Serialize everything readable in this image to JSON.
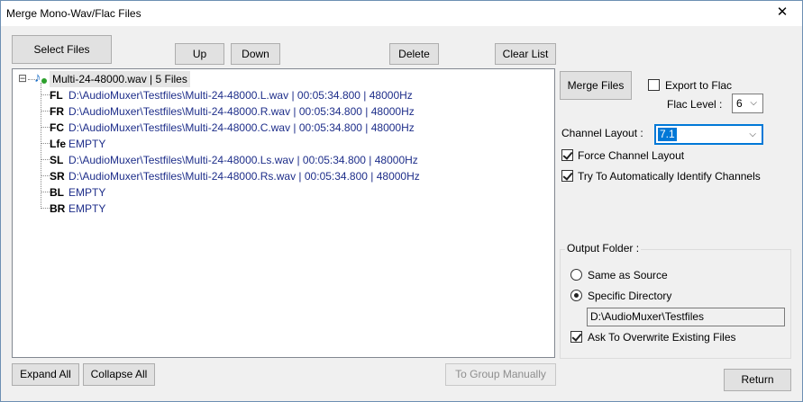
{
  "window": {
    "title": "Merge Mono-Wav/Flac Files",
    "close_symbol": "✕"
  },
  "toolbar": {
    "select_files": "Select Files",
    "up": "Up",
    "down": "Down",
    "delete": "Delete",
    "clear_list": "Clear List"
  },
  "tree": {
    "expand_symbol": "⊟",
    "file_icon_glyph": "♪",
    "root": "Multi-24-48000.wav | 5 Files",
    "items": [
      {
        "label": "FL",
        "text": "D:\\AudioMuxer\\Testfiles\\Multi-24-48000.L.wav | 00:05:34.800 | 48000Hz"
      },
      {
        "label": "FR",
        "text": "D:\\AudioMuxer\\Testfiles\\Multi-24-48000.R.wav | 00:05:34.800 | 48000Hz"
      },
      {
        "label": "FC",
        "text": "D:\\AudioMuxer\\Testfiles\\Multi-24-48000.C.wav | 00:05:34.800 | 48000Hz"
      },
      {
        "label": "Lfe",
        "text": "EMPTY"
      },
      {
        "label": "SL",
        "text": "D:\\AudioMuxer\\Testfiles\\Multi-24-48000.Ls.wav | 00:05:34.800 | 48000Hz"
      },
      {
        "label": "SR",
        "text": "D:\\AudioMuxer\\Testfiles\\Multi-24-48000.Rs.wav | 00:05:34.800 | 48000Hz"
      },
      {
        "label": "BL",
        "text": "EMPTY"
      },
      {
        "label": "BR",
        "text": "EMPTY"
      }
    ]
  },
  "bottom": {
    "expand_all": "Expand All",
    "collapse_all": "Collapse All",
    "to_group_manually": "To Group Manually",
    "return": "Return"
  },
  "right_panel": {
    "merge_files": "Merge Files",
    "export_to_flac": {
      "label": "Export to Flac",
      "checked": false
    },
    "flac_level": {
      "label": "Flac Level :",
      "value": "6"
    },
    "channel_layout": {
      "label": "Channel Layout :",
      "value": "7.1"
    },
    "force_channel_layout": {
      "label": "Force Channel Layout",
      "checked": true
    },
    "auto_identify": {
      "label": "Try To Automatically Identify Channels",
      "checked": true
    },
    "chevron_symbol": "⌵"
  },
  "output_folder": {
    "title": "Output Folder :",
    "same_as_source": {
      "label": "Same as Source",
      "selected": false
    },
    "specific_directory": {
      "label": "Specific Directory",
      "selected": true
    },
    "directory_value": "D:\\AudioMuxer\\Testfiles",
    "ask_overwrite": {
      "label": "Ask To Overwrite Existing Files",
      "checked": true
    }
  },
  "colors": {
    "tree_text": "#1e2e8a",
    "selection": "#0078d7",
    "window_bg": "#f0f0f0"
  }
}
